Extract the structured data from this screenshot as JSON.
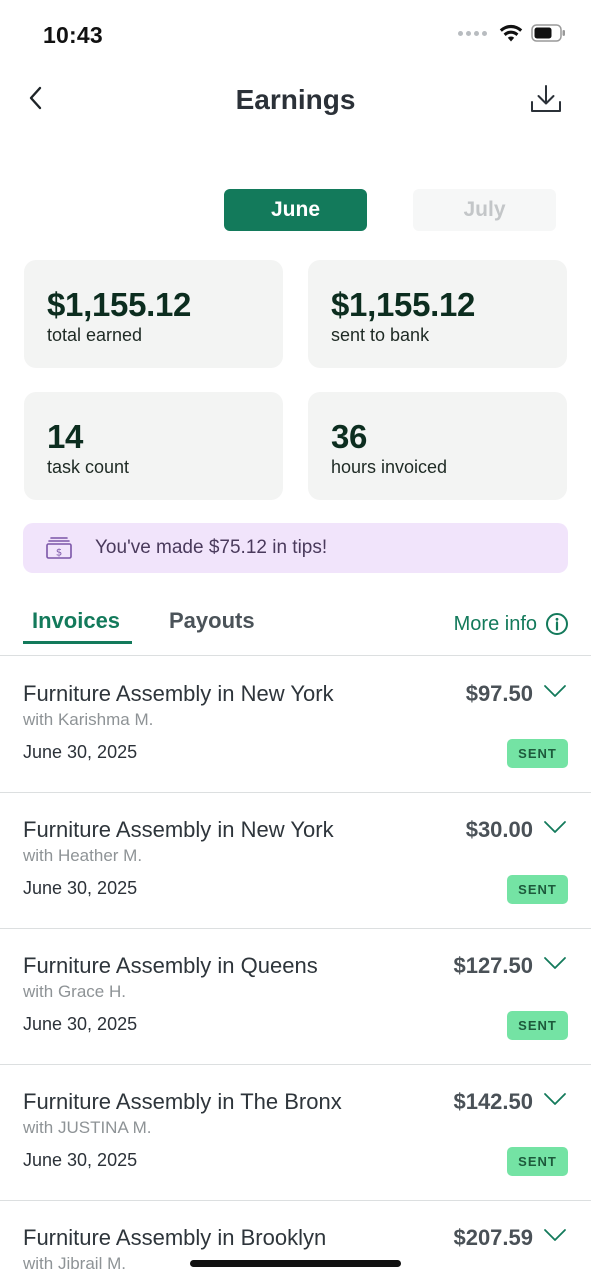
{
  "status_bar": {
    "time": "10:43"
  },
  "header": {
    "title": "Earnings"
  },
  "month_toggle": {
    "active": "June",
    "inactive": "July"
  },
  "stats": {
    "total_earned": {
      "value": "$1,155.12",
      "label": "total earned"
    },
    "sent_to_bank": {
      "value": "$1,155.12",
      "label": "sent to bank"
    },
    "task_count": {
      "value": "14",
      "label": "task count"
    },
    "hours_invoiced": {
      "value": "36",
      "label": "hours invoiced"
    }
  },
  "tips_banner": {
    "text": "You've made $75.12 in tips!"
  },
  "tabs": {
    "invoices": "Invoices",
    "payouts": "Payouts",
    "more_info": "More info"
  },
  "invoices": [
    {
      "title": "Furniture Assembly in New York",
      "client": "with Karishma M.",
      "date": "June 30, 2025",
      "amount": "$97.50",
      "status": "SENT"
    },
    {
      "title": "Furniture Assembly in New York",
      "client": "with Heather M.",
      "date": "June 30, 2025",
      "amount": "$30.00",
      "status": "SENT"
    },
    {
      "title": "Furniture Assembly in Queens",
      "client": "with Grace H.",
      "date": "June 30, 2025",
      "amount": "$127.50",
      "status": "SENT"
    },
    {
      "title": "Furniture Assembly in The Bronx",
      "client": "with JUSTINA M.",
      "date": "June 30, 2025",
      "amount": "$142.50",
      "status": "SENT"
    },
    {
      "title": "Furniture Assembly in Brooklyn",
      "client": "with Jibrail M.",
      "date": "",
      "amount": "$207.59",
      "status": ""
    }
  ],
  "colors": {
    "accent": "#137a5b",
    "card_bg": "#f3f4f3",
    "tips_bg": "#f1e4fb",
    "badge_bg": "#74e3a4"
  },
  "icons": {
    "back": "chevron-left-icon",
    "download": "download-icon",
    "tips": "money-stack-icon",
    "more_info": "info-circle-icon",
    "row_expand": "chevron-down-icon"
  }
}
